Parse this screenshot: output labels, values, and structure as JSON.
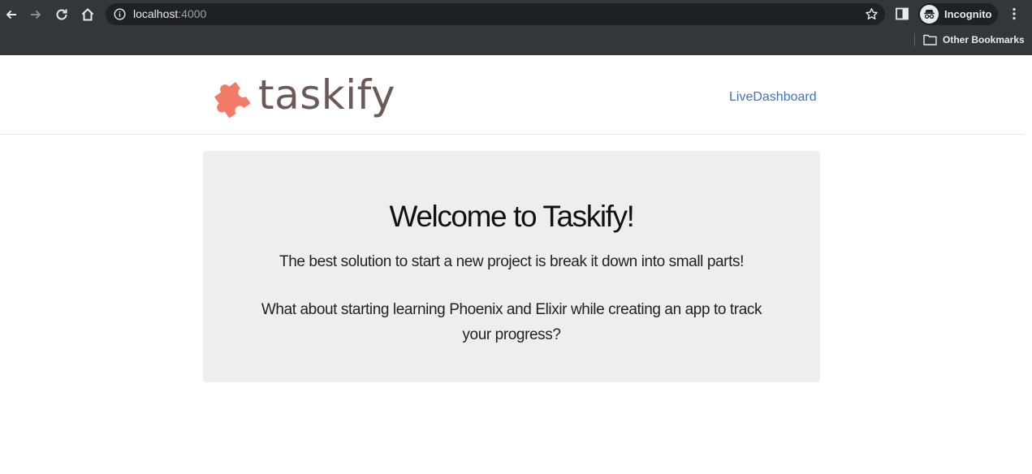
{
  "browser": {
    "url_host": "localhost",
    "url_port": ":4000",
    "profile_label": "Incognito",
    "bookmark_folder": "Other Bookmarks"
  },
  "header": {
    "brand": "taskify",
    "nav_link": "LiveDashboard"
  },
  "hero": {
    "title": "Welcome to Taskify!",
    "lead": "The best solution to start a new project is break it down into small parts!",
    "text": "What about starting learning Phoenix and Elixir while creating an app to track your progress?"
  },
  "colors": {
    "logo_accent": "#f27b68",
    "brand_text": "#6b5a57",
    "link": "#3b74c2",
    "hero_bg": "#eeeeee"
  }
}
